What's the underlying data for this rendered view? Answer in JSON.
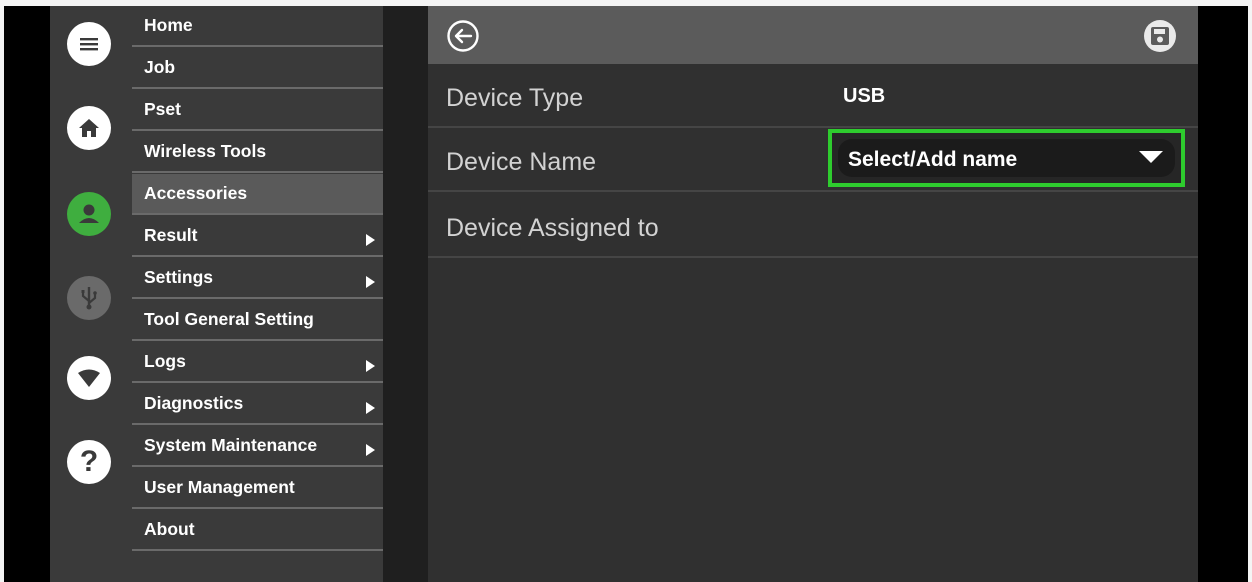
{
  "sidebar": {
    "icons": [
      "menu-icon",
      "home-icon",
      "user-icon",
      "usb-icon",
      "wifi-icon",
      "help-icon"
    ],
    "items": [
      {
        "label": "Home",
        "submenu": false
      },
      {
        "label": "Job",
        "submenu": false
      },
      {
        "label": "Pset",
        "submenu": false
      },
      {
        "label": "Wireless Tools",
        "submenu": false
      },
      {
        "label": "Accessories",
        "submenu": false,
        "active": true
      },
      {
        "label": "Result",
        "submenu": true
      },
      {
        "label": "Settings",
        "submenu": true
      },
      {
        "label": "Tool General Setting",
        "submenu": false
      },
      {
        "label": "Logs",
        "submenu": true
      },
      {
        "label": "Diagnostics",
        "submenu": true
      },
      {
        "label": "System Maintenance",
        "submenu": true
      },
      {
        "label": "User Management",
        "submenu": false
      },
      {
        "label": "About",
        "submenu": false
      }
    ]
  },
  "header": {
    "back_icon": "back-arrow-icon",
    "save_icon": "save-icon"
  },
  "form": {
    "device_type_label": "Device Type",
    "device_type_value": "USB",
    "device_name_label": "Device Name",
    "device_name_select": "Select/Add name",
    "device_assigned_label": "Device Assigned to"
  },
  "colors": {
    "accent_green": "#2ecc2e",
    "user_icon_green": "#3fae3f",
    "panel_bg": "#303030",
    "header_bg": "#5b5b5b"
  }
}
